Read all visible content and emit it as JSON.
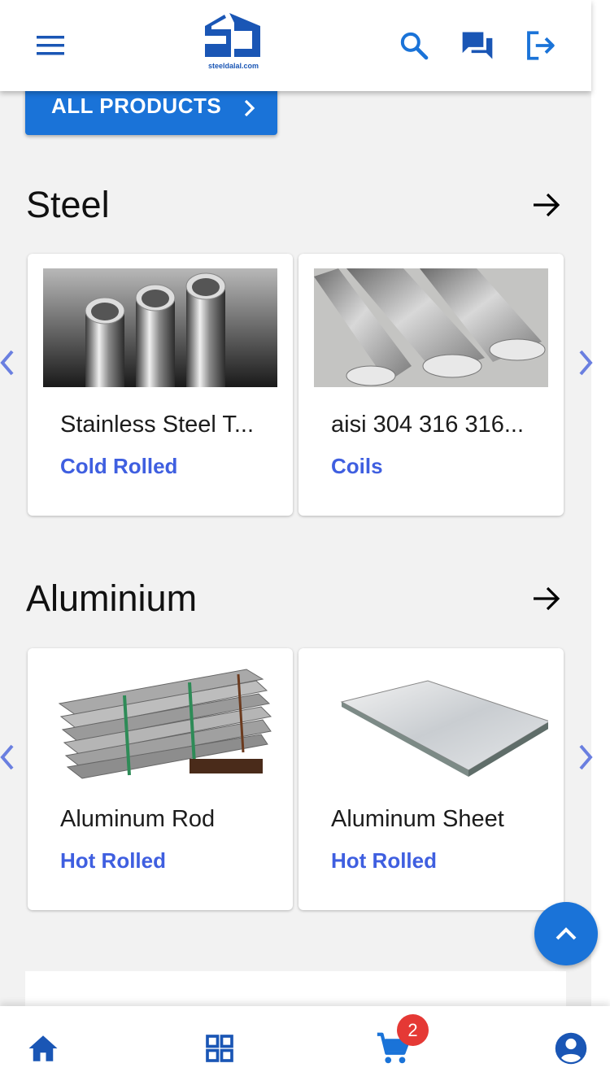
{
  "header": {
    "logo_text": "steeldalal.com",
    "icons": [
      "menu-icon",
      "search-icon",
      "chat-icon",
      "logout-icon"
    ]
  },
  "all_products": {
    "label": "ALL PRODUCTS"
  },
  "sections": [
    {
      "title": "Steel",
      "products": [
        {
          "name": "Stainless Steel T...",
          "subtitle": "Cold Rolled"
        },
        {
          "name": "aisi 304 316 316...",
          "subtitle": "Coils"
        }
      ]
    },
    {
      "title": "Aluminium",
      "products": [
        {
          "name": "Aluminum Rod",
          "subtitle": "Hot Rolled"
        },
        {
          "name": "Aluminum Sheet",
          "subtitle": "Hot Rolled"
        }
      ]
    }
  ],
  "bottom_nav": {
    "cart_badge": "2",
    "items": [
      "home-icon",
      "categories-icon",
      "cart-icon",
      "account-icon"
    ]
  },
  "colors": {
    "primary": "#1a73d8",
    "accent_text": "#3f5fe0",
    "badge": "#e53935",
    "background": "#f2f2f2"
  }
}
